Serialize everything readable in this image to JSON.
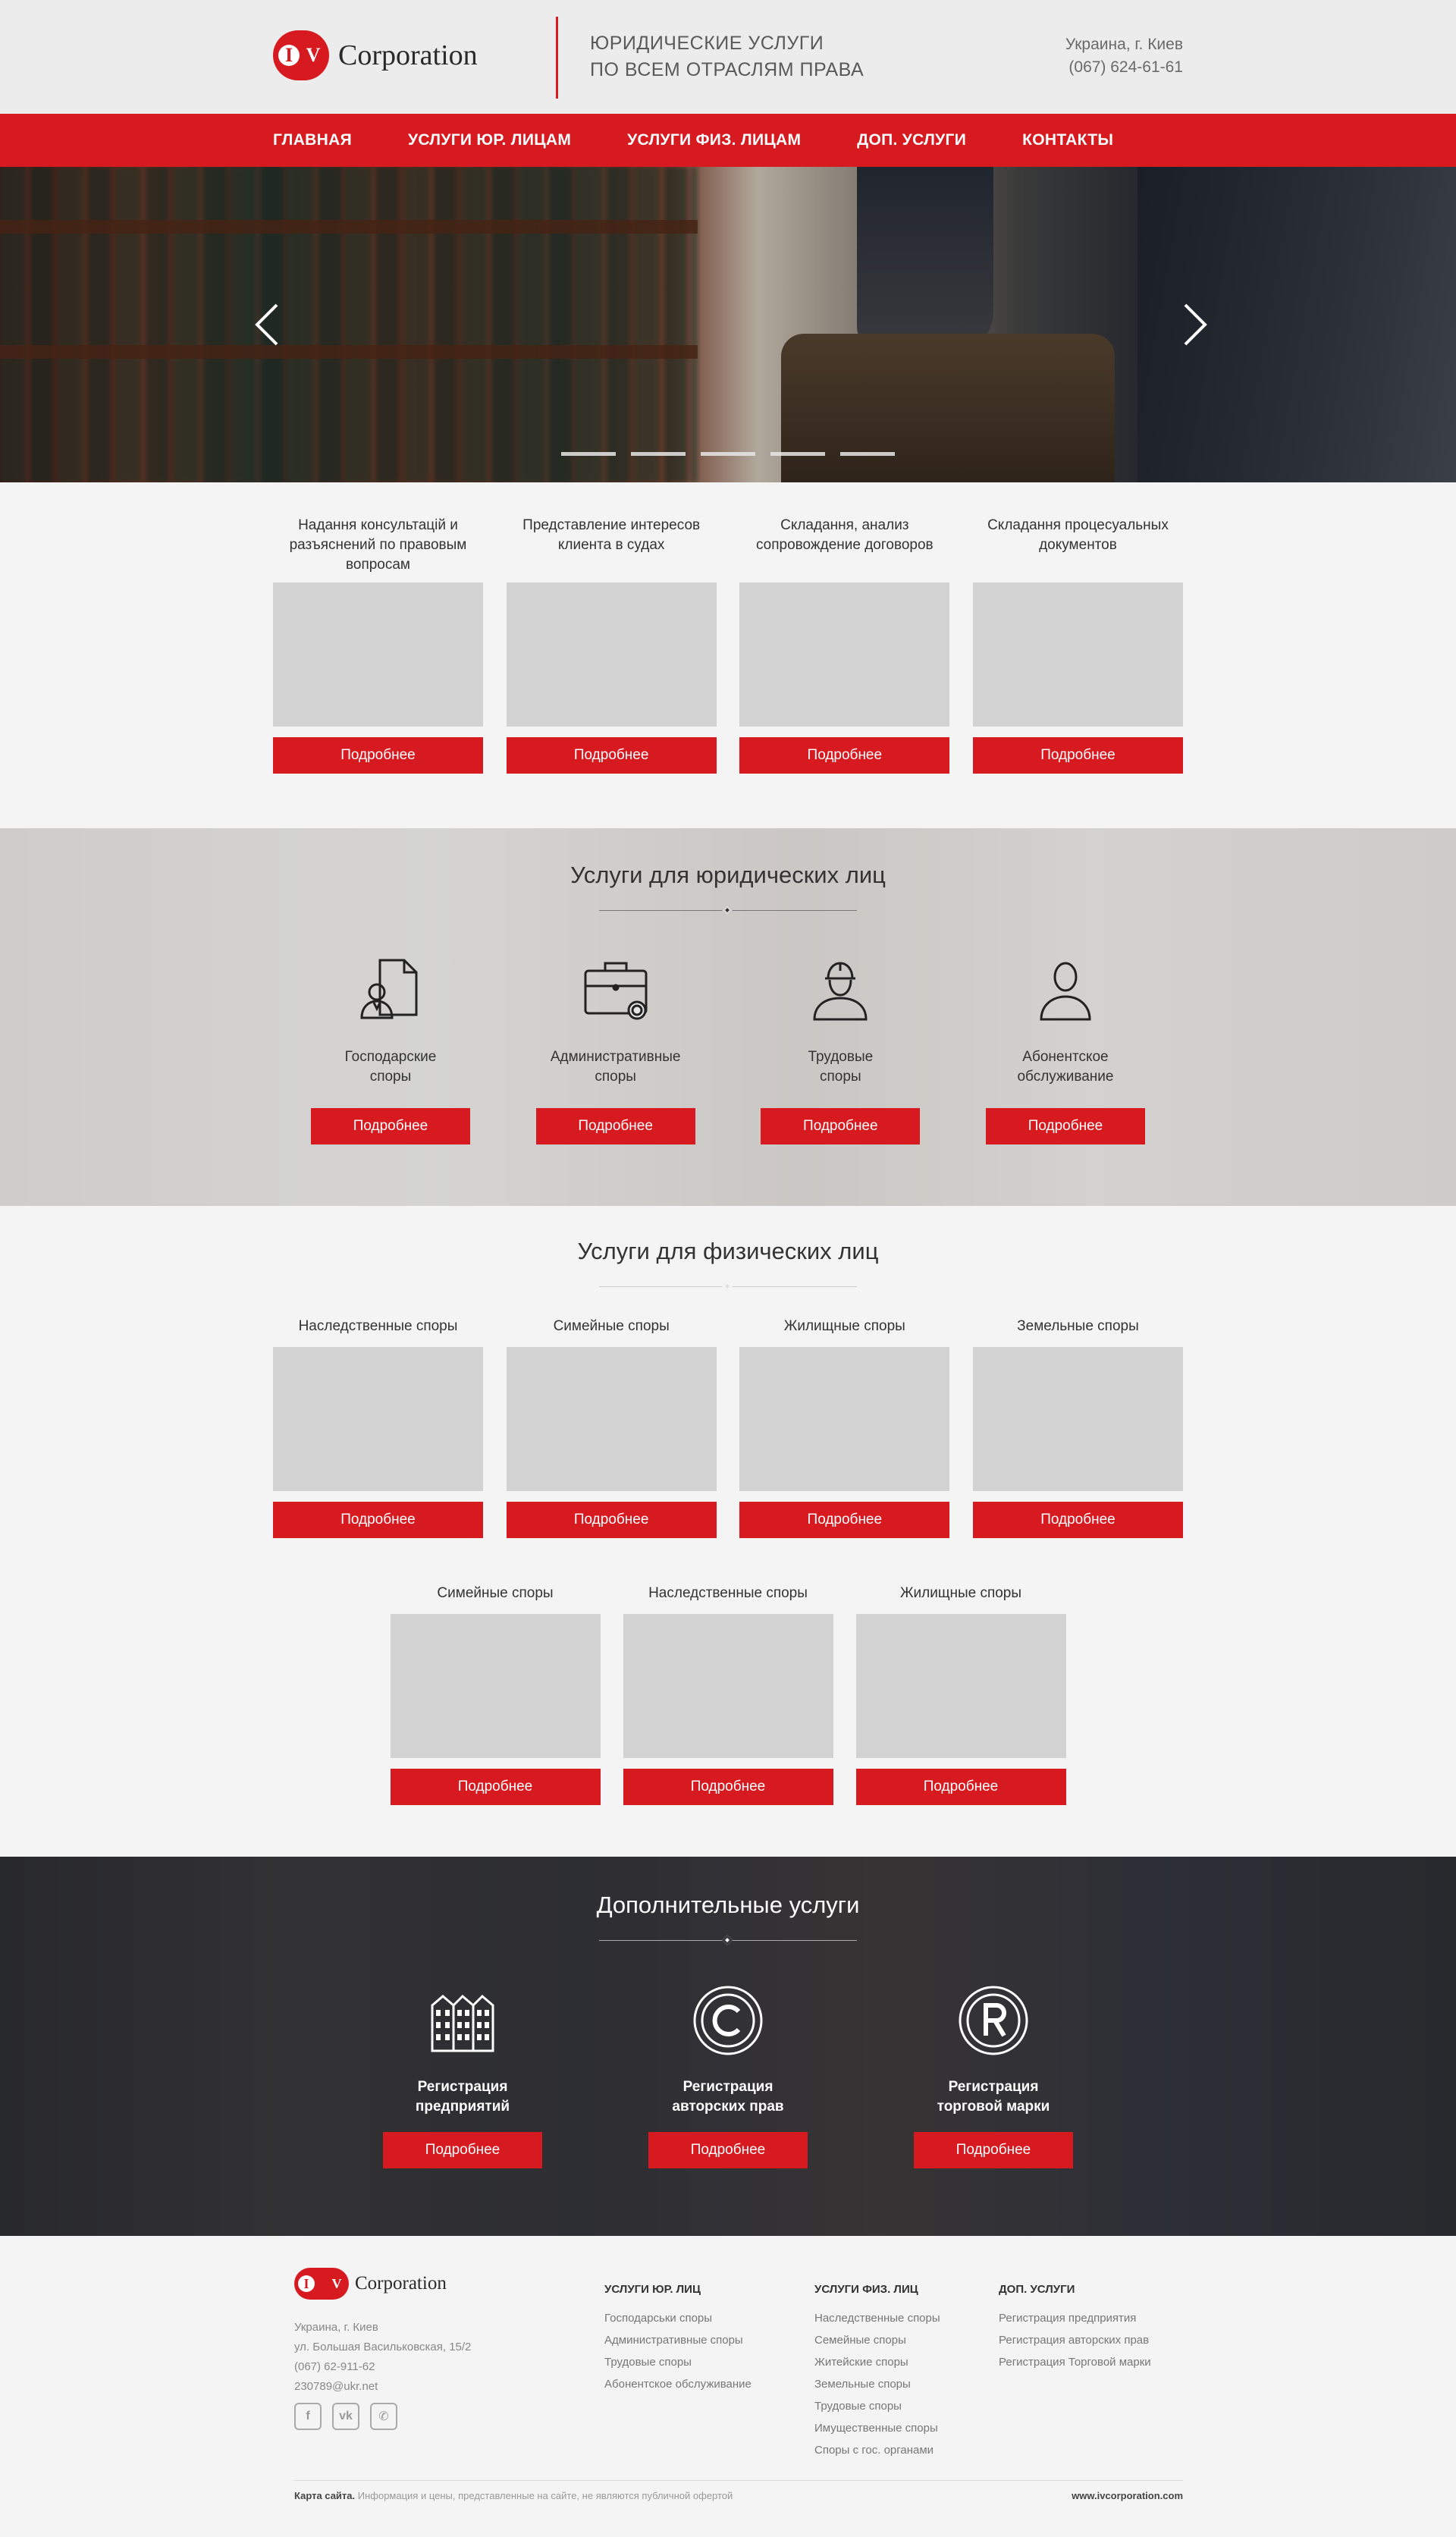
{
  "header": {
    "logo_letter1": "I",
    "logo_letter2": "V",
    "logo_text": "Corporation",
    "tagline_line1": "ЮРИДИЧЕСКИЕ УСЛУГИ",
    "tagline_line2": "ПО ВСЕМ ОТРАСЛЯМ ПРАВА",
    "location": "Украина, г. Киев",
    "phone": "(067) 624-61-61"
  },
  "nav": {
    "items": [
      "ГЛАВНАЯ",
      "УСЛУГИ ЮР. ЛИЦАМ",
      "УСЛУГИ ФИЗ. ЛИЦАМ",
      "ДОП. УСЛУГИ",
      "КОНТАКТЫ"
    ]
  },
  "hero": {
    "slide_count": 5,
    "arrow_prev": "chevron-left-icon",
    "arrow_next": "chevron-right-icon"
  },
  "main_services": {
    "button_label": "Подробнее",
    "items": [
      "Надання консультацій и разъяснений по правовым вопросам",
      "Представление интересов клиента в судах",
      "Складання, анализ сопровождение договоров",
      "Складання процесуальных документов"
    ]
  },
  "legal": {
    "title": "Услуги для юридических лиц",
    "button_label": "Подробнее",
    "items": [
      {
        "label_line1": "Господарские",
        "label_line2": "споры",
        "icon": "document-person-icon"
      },
      {
        "label_line1": "Административные",
        "label_line2": "споры",
        "icon": "briefcase-seal-icon"
      },
      {
        "label_line1": "Трудовые",
        "label_line2": "споры",
        "icon": "worker-helmet-icon"
      },
      {
        "label_line1": "Абонентское",
        "label_line2": "обслуживание",
        "icon": "person-icon"
      }
    ]
  },
  "physical": {
    "title": "Услуги для физических лиц",
    "button_label": "Подробнее",
    "row1": [
      "Наследственные споры",
      "Симейные споры",
      "Жилищные споры",
      "Земельные споры"
    ],
    "row2": [
      "Симейные споры",
      "Наследственные споры",
      "Жилищные споры"
    ]
  },
  "extra": {
    "title": "Дополнительные услуги",
    "button_label": "Подробнее",
    "items": [
      {
        "label_line1": "Регистрация",
        "label_line2": "предприятий",
        "icon": "buildings-icon"
      },
      {
        "label_line1": "Регистрация",
        "label_line2": "авторских прав",
        "icon": "copyright-icon"
      },
      {
        "label_line1": "Регистрация",
        "label_line2": "торговой марки",
        "icon": "registered-icon"
      }
    ]
  },
  "footer": {
    "logo_text": "Corporation",
    "address": [
      "Украина, г. Киев",
      "ул. Большая Васильковская, 15/2",
      "(067) 62-911-62",
      "230789@ukr.net"
    ],
    "socials": [
      "facebook-icon",
      "vk-icon",
      "viber-icon"
    ],
    "col1": {
      "title": "УСЛУГИ ЮР. ЛИЦ",
      "items": [
        "Господарськи споры",
        "Административные споры",
        "Трудовые споры",
        "Абонентское обслуживание"
      ]
    },
    "col2": {
      "title": "УСЛУГИ ФИЗ. ЛИЦ",
      "items": [
        "Наследственные споры",
        "Семейные споры",
        "Житейские споры",
        "Земельные споры",
        "Трудовые споры",
        "Имущественные споры",
        "Споры с гос. органами"
      ]
    },
    "col3": {
      "title": "ДОП. УСЛУГИ",
      "items": [
        "Регистрация предприятия",
        "Регистрация авторских прав",
        "Регистрация Торговой марки"
      ]
    },
    "sitemap_label": "Карта сайта.",
    "disclaimer": "Информация и цены, представленные на сайте, не являются публичной офертой",
    "domain": "www.ivcorporation.com"
  },
  "colors": {
    "accent": "#d71920",
    "header_bg": "#ececec",
    "page_bg": "#f4f4f4"
  }
}
